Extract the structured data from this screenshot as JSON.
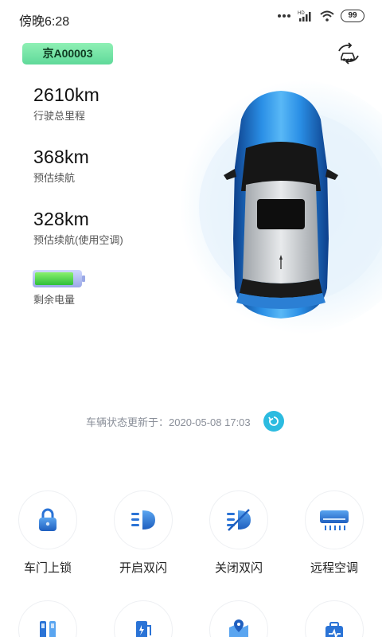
{
  "status_bar": {
    "time": "傍晚6:28",
    "battery": "99"
  },
  "vehicle": {
    "plate": "京A00003"
  },
  "stats": [
    {
      "value": "2610km",
      "label": "行驶总里程"
    },
    {
      "value": "368km",
      "label": "预估续航"
    },
    {
      "value": "328km",
      "label": "预估续航(使用空调)"
    }
  ],
  "battery": {
    "label": "剩余电量",
    "level": 0.85
  },
  "update": {
    "text": "车辆状态更新于：2020-05-08 17:03"
  },
  "actions": [
    {
      "label": "车门上锁",
      "icon": "lock-icon"
    },
    {
      "label": "开启双闪",
      "icon": "hazard-on-icon"
    },
    {
      "label": "关闭双闪",
      "icon": "hazard-off-icon"
    },
    {
      "label": "远程空调",
      "icon": "air-conditioner-icon"
    }
  ],
  "actions_row2": [
    {
      "icon": "charging-icon"
    },
    {
      "icon": "charging-station-icon"
    },
    {
      "icon": "map-location-icon"
    },
    {
      "icon": "service-icon"
    }
  ],
  "colors": {
    "accent": "#2cbbe0",
    "icon_blue": "#2a73d6",
    "plate_green": "#6ee2a4",
    "car_blue": "#1f6fd1"
  }
}
